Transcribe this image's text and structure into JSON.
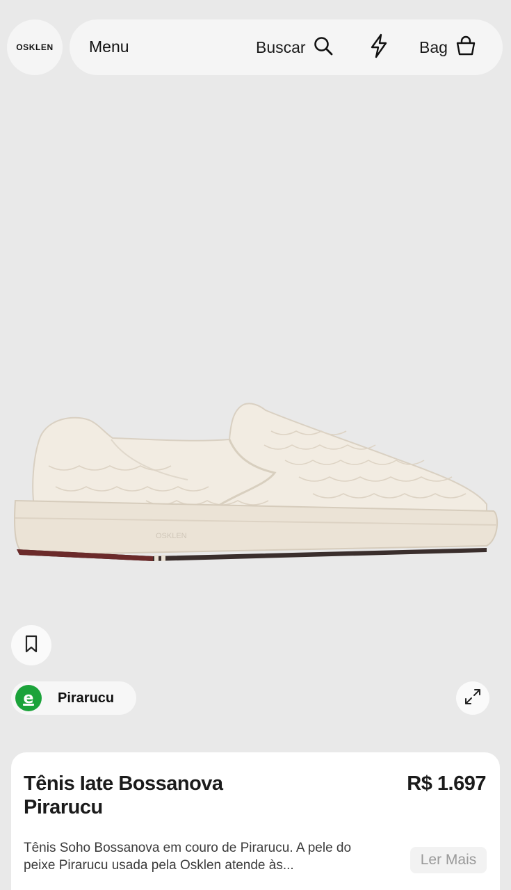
{
  "header": {
    "logo_text": "OSKLEN",
    "menu_label": "Menu",
    "search_label": "Buscar",
    "search_icon": "search-icon",
    "bolt_icon": "lightning-bolt-icon",
    "bag_label": "Bag",
    "bag_icon": "shopping-bag-icon"
  },
  "product": {
    "image_name": "slip-on-sneaker-product-image",
    "save_icon": "bookmark-icon",
    "material": {
      "label": "Pirarucu",
      "badge_letter": "e",
      "badge_color": "#1ba33a"
    },
    "expand_icon": "expand-icon",
    "title": "Tênis Iate Bossanova Pirarucu",
    "price": "R$ 1.697",
    "description": "Tênis Soho Bossanova em couro de Pirarucu. A pele do peixe Pirarucu usada pela Osklen atende às...",
    "read_more_label": "Ler Mais"
  },
  "colors": {
    "background": "#e9e9e9",
    "surface": "#f5f5f5",
    "card": "#ffffff",
    "accent_green": "#1ba33a",
    "muted_text": "#9a9a9a"
  }
}
